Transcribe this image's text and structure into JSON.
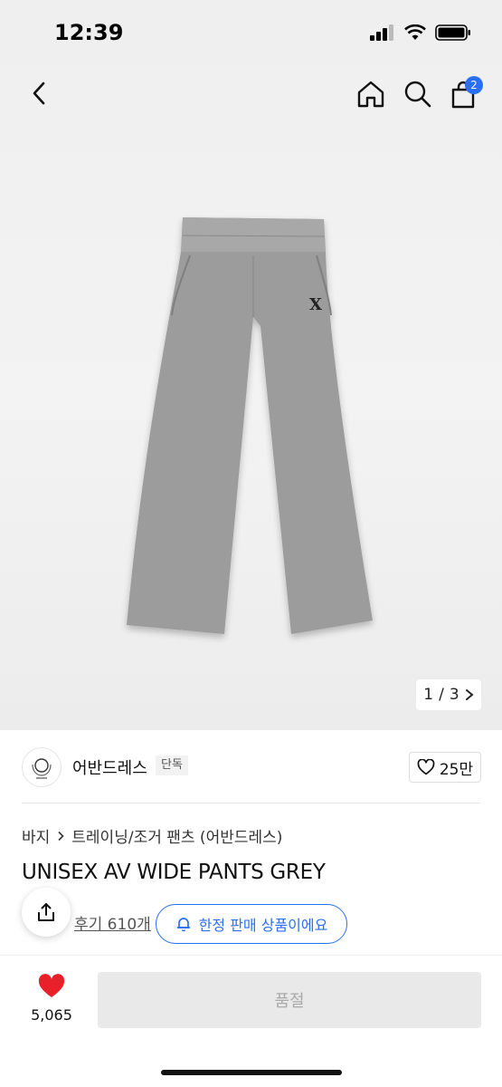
{
  "status": {
    "time": "12:39"
  },
  "nav": {
    "cart_count": "2"
  },
  "gallery": {
    "current": "1",
    "separator": "/",
    "total": "3"
  },
  "brand": {
    "name": "어반드레스",
    "tag": "단독",
    "likes": "25만"
  },
  "breadcrumb": {
    "first": "바지",
    "second": "트레이닝/조거 팬츠 (어반드레스)"
  },
  "product": {
    "title": "UNISEX AV WIDE PANTS GREY"
  },
  "review": {
    "link_label": "후기 610개"
  },
  "limited": {
    "label": "한정 판매 상품이에요"
  },
  "bottom": {
    "wish_count": "5,065",
    "buy_label": "품절"
  },
  "colors": {
    "accent": "#2a6ff3",
    "heart": "#e8202a",
    "pants": "#9a9a9a"
  }
}
